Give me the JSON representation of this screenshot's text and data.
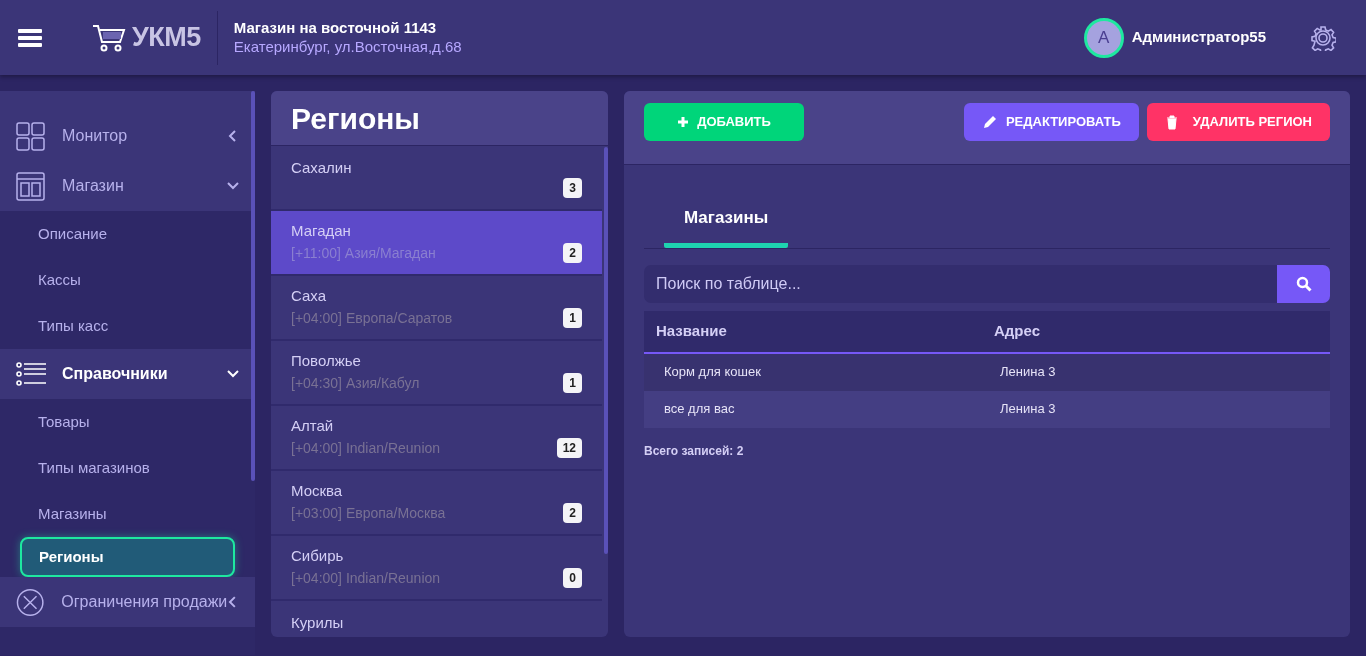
{
  "header": {
    "brand": "УКМ5",
    "store_name": "Магазин на восточной 1143",
    "store_address": "Екатеринбург, ул.Восточная,д.68",
    "user": {
      "initial": "A",
      "name": "Администратор55"
    }
  },
  "sidebar": {
    "items": [
      {
        "label": "Монитор",
        "expanded": false,
        "active": false
      },
      {
        "label": "Магазин",
        "expanded": true,
        "active": false,
        "children": [
          {
            "label": "Описание",
            "selected": false
          },
          {
            "label": "Кассы",
            "selected": false
          },
          {
            "label": "Типы касс",
            "selected": false
          }
        ]
      },
      {
        "label": "Справочники",
        "expanded": true,
        "active": true,
        "children": [
          {
            "label": "Товары",
            "selected": false
          },
          {
            "label": "Типы магазинов",
            "selected": false
          },
          {
            "label": "Магазины",
            "selected": false
          },
          {
            "label": "Регионы",
            "selected": true
          }
        ]
      },
      {
        "label": "Ограничения продажи",
        "expanded": false,
        "active": false
      }
    ]
  },
  "regions": {
    "title": "Регионы",
    "items": [
      {
        "name": "Сахалин",
        "count": "3",
        "selected": false
      },
      {
        "name": "Магадан",
        "timezone": "[+11:00] Азия/Магадан",
        "count": "2",
        "selected": true
      },
      {
        "name": "Саха",
        "timezone": "[+04:00] Европа/Саратов",
        "count": "1",
        "selected": false
      },
      {
        "name": "Поволжье",
        "timezone": "[+04:30] Азия/Кабул",
        "count": "1",
        "selected": false
      },
      {
        "name": "Алтай",
        "timezone": "[+04:00] Indian/Reunion",
        "count": "12",
        "selected": false
      },
      {
        "name": "Москва",
        "timezone": "[+03:00] Европа/Москва",
        "count": "2",
        "selected": false
      },
      {
        "name": "Сибирь",
        "timezone": "[+04:00] Indian/Reunion",
        "count": "0",
        "selected": false
      },
      {
        "name": "Курилы",
        "selected": false
      }
    ]
  },
  "detail": {
    "buttons": [
      {
        "kind": "add",
        "label": "ДОБАВИТЬ"
      },
      {
        "kind": "edit",
        "label": "РЕДАКТИРОВАТЬ"
      },
      {
        "kind": "delete",
        "label": "УДАЛИТЬ РЕГИОН"
      }
    ],
    "tabs": [
      {
        "label": "Магазины",
        "selected": true
      }
    ],
    "search": {
      "placeholder": "Поиск по таблице..."
    },
    "table": {
      "columns": [
        "Название",
        "Адрес"
      ],
      "rows": [
        [
          "Корм для кошек",
          "Ленина 3"
        ],
        [
          "все для вас",
          "Ленина 3"
        ]
      ]
    },
    "total": "Всего записей: 2"
  }
}
